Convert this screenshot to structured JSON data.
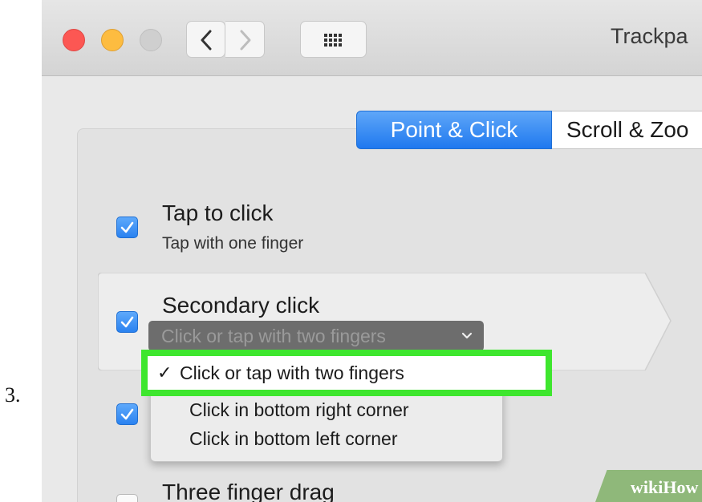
{
  "step_number": "3.",
  "window": {
    "title": "Trackpa",
    "controls": {
      "close": "close-button",
      "minimize": "minimize-button",
      "zoom": "zoom-button"
    },
    "nav_icons": [
      "back-chevron-icon",
      "forward-chevron-icon",
      "grid-icon"
    ]
  },
  "tabs": {
    "active": "Point & Click",
    "inactive": "Scroll & Zoo"
  },
  "options": {
    "tap_to_click": {
      "label": "Tap to click",
      "sub": "Tap with one finger",
      "checked": true
    },
    "secondary_click": {
      "label": "Secondary click",
      "popup_value": "Click or tap with two fingers",
      "checked": true
    },
    "third_checkbox": {
      "checked": true
    },
    "three_finger_drag": {
      "label": "Three finger drag",
      "checked": false
    }
  },
  "menu": {
    "items": [
      {
        "label": "Click or tap with two fingers",
        "checked": true
      },
      {
        "label": "Click in bottom right corner",
        "checked": false
      },
      {
        "label": "Click in bottom left corner",
        "checked": false
      }
    ],
    "check_glyph": "✓"
  },
  "watermark": {
    "part1": "wiki",
    "part2": "How"
  },
  "colors": {
    "accent": "#2a82f0",
    "highlight": "#3ee62e",
    "watermark_bg": "#8fb87a"
  }
}
